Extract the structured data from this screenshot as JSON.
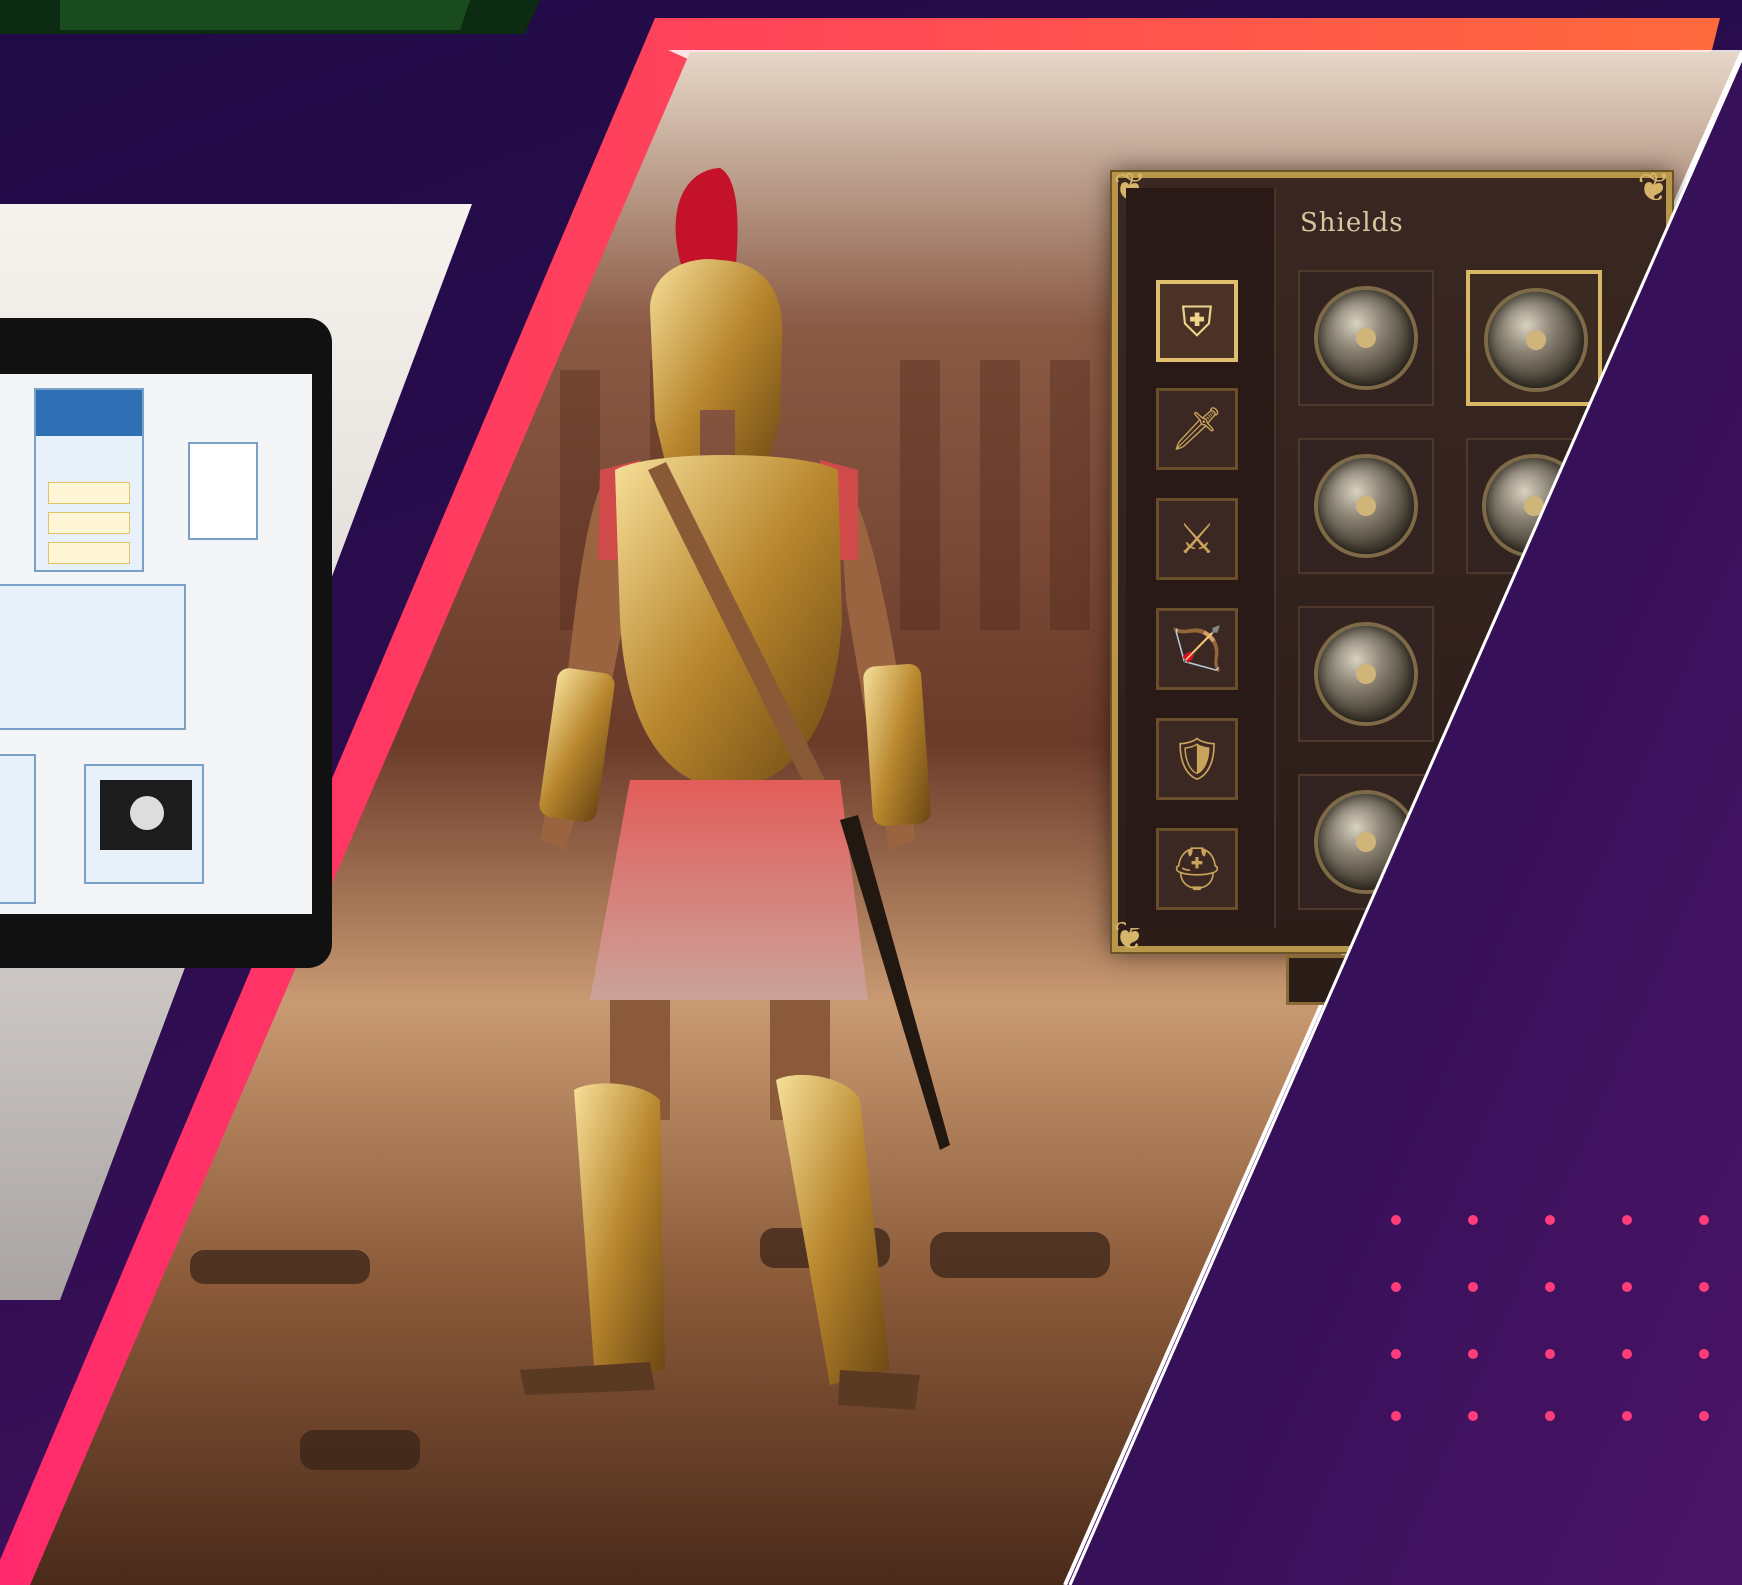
{
  "inventory": {
    "section_title": "Shields",
    "categories": [
      {
        "name": "Shields",
        "icon": "shield-icon",
        "glyph": "⛨",
        "active": true
      },
      {
        "name": "Sword",
        "icon": "sword-icon",
        "glyph": "🗡",
        "active": false
      },
      {
        "name": "Spears",
        "icon": "crossed-spears-icon",
        "glyph": "⚔",
        "active": false
      },
      {
        "name": "Bow",
        "icon": "bow-icon",
        "glyph": "🏹",
        "active": false
      },
      {
        "name": "Armor",
        "icon": "armor-icon",
        "glyph": "🛡",
        "active": false
      },
      {
        "name": "Helmet",
        "icon": "helmet-icon",
        "glyph": "⛑",
        "active": false
      }
    ],
    "selected_slot": 1
  },
  "colors": {
    "accent_pink": "#ff3d7a",
    "panel_gold": "#b8964a",
    "background_purple": "#200b46"
  }
}
